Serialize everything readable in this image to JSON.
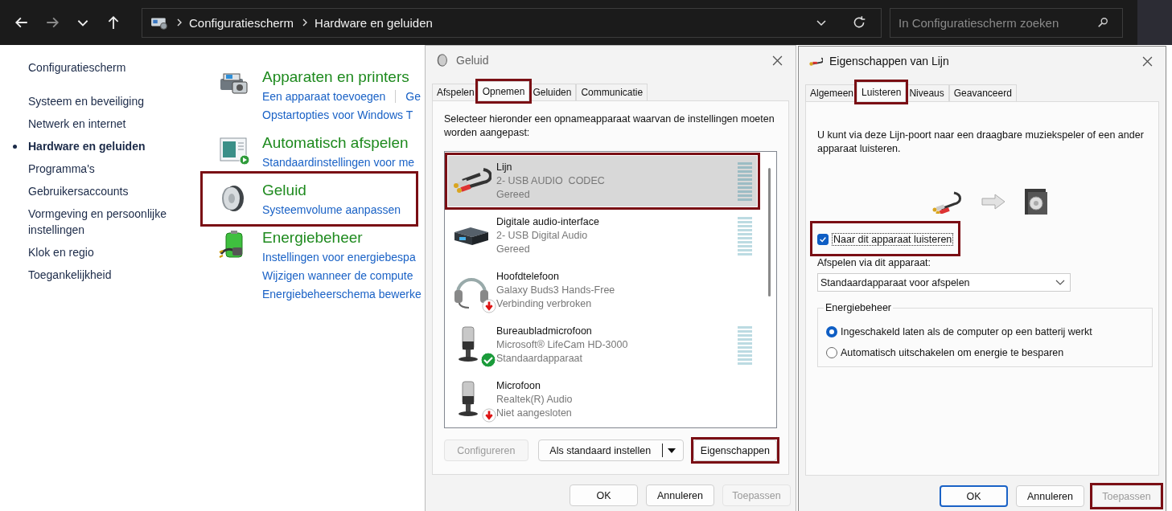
{
  "explorer": {
    "nav": [
      {
        "kind": "back",
        "disabled": false
      },
      {
        "kind": "forward",
        "disabled": true
      },
      {
        "kind": "recent",
        "disabled": false
      },
      {
        "kind": "up",
        "disabled": false
      }
    ],
    "breadcrumbs": [
      "Configuratiescherm",
      "Hardware en geluiden"
    ],
    "search": {
      "placeholder": "In Configuratiescherm zoeken"
    }
  },
  "sidebar": {
    "home": "Configuratiescherm",
    "items": [
      {
        "label": "Systeem en beveiliging",
        "selected": false
      },
      {
        "label": "Netwerk en internet",
        "selected": false
      },
      {
        "label": "Hardware en geluiden",
        "selected": true
      },
      {
        "label": "Programma's",
        "selected": false
      },
      {
        "label": "Gebruikersaccounts",
        "selected": false
      },
      {
        "label": "Vormgeving en persoonlijke instellingen",
        "selected": false
      },
      {
        "label": "Klok en regio",
        "selected": false
      },
      {
        "label": "Toegankelijkheid",
        "selected": false
      }
    ]
  },
  "categories": [
    {
      "kind": "devices",
      "title": "Apparaten en printers",
      "highlighted": false,
      "link_rows": [
        [
          "Een apparaat toevoegen",
          "Ge"
        ],
        [
          "Opstartopties voor Windows T"
        ]
      ]
    },
    {
      "kind": "autoplay",
      "title": "Automatisch afspelen",
      "highlighted": false,
      "link_rows": [
        [
          "Standaardinstellingen voor me"
        ]
      ]
    },
    {
      "kind": "sound",
      "title": "Geluid",
      "highlighted": true,
      "link_rows": [
        [
          "Systeemvolume aanpassen"
        ]
      ]
    },
    {
      "kind": "power",
      "title": "Energiebeheer",
      "highlighted": false,
      "link_rows": [
        [
          "Instellingen voor energiebespa"
        ],
        [
          "Wijzigen wanneer de compute"
        ],
        [
          "Energiebeheerschema bewerke"
        ]
      ]
    }
  ],
  "sound_dialog": {
    "title": "Geluid",
    "tabs": [
      {
        "label": "Afspelen",
        "selected": false,
        "highlighted": false
      },
      {
        "label": "Opnemen",
        "selected": true,
        "highlighted": true
      },
      {
        "label": "Geluiden",
        "selected": false,
        "highlighted": false
      },
      {
        "label": "Communicatie",
        "selected": false,
        "highlighted": false
      }
    ],
    "instruction": "Selecteer hieronder een opnameapparaat waarvan de instellingen moeten worden aangepast:",
    "devices": [
      {
        "kind": "cable",
        "name": "Lijn",
        "driver": "2- USB AUDIO  CODEC",
        "status": "Gereed",
        "selected": true,
        "highlighted": true,
        "meter": true,
        "unplugged": false,
        "default": false
      },
      {
        "kind": "interface",
        "name": "Digitale audio-interface",
        "driver": "2- USB Digital Audio",
        "status": "Gereed",
        "selected": false,
        "highlighted": false,
        "meter": true,
        "unplugged": false,
        "default": false
      },
      {
        "kind": "headset",
        "name": "Hoofdtelefoon",
        "driver": "Galaxy Buds3 Hands-Free",
        "status": "Verbinding verbroken",
        "selected": false,
        "highlighted": false,
        "meter": false,
        "unplugged": true,
        "default": false
      },
      {
        "kind": "microphone",
        "name": "Bureaubladmicrofoon",
        "driver": "Microsoft® LifeCam HD-3000",
        "status": "Standaardapparaat",
        "selected": false,
        "highlighted": false,
        "meter": true,
        "unplugged": false,
        "default": true
      },
      {
        "kind": "microphone",
        "name": "Microfoon",
        "driver": "Realtek(R) Audio",
        "status": "Niet aangesloten",
        "selected": false,
        "highlighted": false,
        "meter": false,
        "unplugged": true,
        "default": false
      }
    ],
    "actions": [
      {
        "kind": "plain",
        "label": "Configureren",
        "disabled": true,
        "highlighted": false
      },
      {
        "kind": "split",
        "label": "Als standaard instellen",
        "disabled": false,
        "highlighted": false
      },
      {
        "kind": "plain",
        "label": "Eigenschappen",
        "disabled": false,
        "highlighted": true
      }
    ],
    "buttons": [
      {
        "label": "OK",
        "default": false,
        "disabled": false,
        "highlighted": false
      },
      {
        "label": "Annuleren",
        "default": false,
        "disabled": false,
        "highlighted": false
      },
      {
        "label": "Toepassen",
        "default": false,
        "disabled": true,
        "highlighted": false
      }
    ]
  },
  "properties_dialog": {
    "title": "Eigenschappen van Lijn",
    "tabs": [
      {
        "label": "Algemeen",
        "selected": false,
        "highlighted": false
      },
      {
        "label": "Luisteren",
        "selected": true,
        "highlighted": true
      },
      {
        "label": "Niveaus",
        "selected": false,
        "highlighted": false
      },
      {
        "label": "Geavanceerd",
        "selected": false,
        "highlighted": false
      }
    ],
    "description": "U kunt via deze Lijn-poort naar een draagbare muziekspeler of een ander apparaat luisteren.",
    "listen": {
      "label": "Naar dit apparaat luisteren",
      "checked": true,
      "highlighted": true
    },
    "playback_label": "Afspelen via dit apparaat:",
    "playback_device": {
      "value": "Standaardapparaat voor afspelen"
    },
    "power": {
      "title": "Energiebeheer",
      "options": [
        {
          "label": "Ingeschakeld laten als de computer op een batterij werkt",
          "selected": true
        },
        {
          "label": "Automatisch uitschakelen om energie te besparen",
          "selected": false
        }
      ]
    },
    "buttons": [
      {
        "label": "OK",
        "default": true,
        "disabled": false,
        "highlighted": false
      },
      {
        "label": "Annuleren",
        "default": false,
        "disabled": false,
        "highlighted": false
      },
      {
        "label": "Toepassen",
        "default": false,
        "disabled": true,
        "highlighted": true
      }
    ]
  }
}
